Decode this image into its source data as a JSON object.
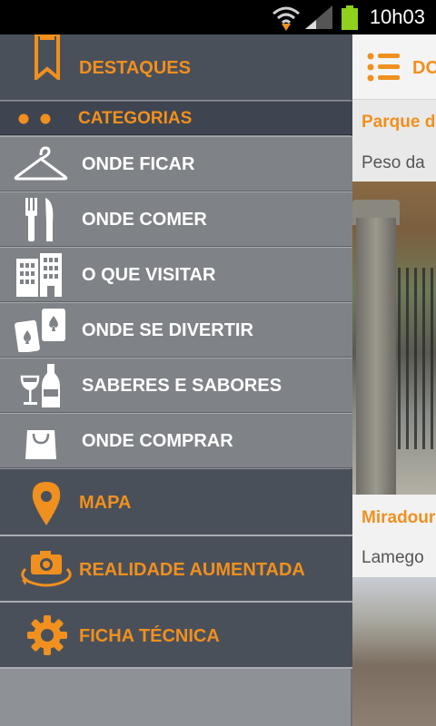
{
  "status_bar": {
    "time": "10h03"
  },
  "drawer": {
    "destaques_label": "DESTAQUES",
    "categorias_label": "CATEGORIAS",
    "categories": [
      {
        "label": "ONDE FICAR",
        "icon": "hanger-icon"
      },
      {
        "label": "ONDE COMER",
        "icon": "fork-knife-icon"
      },
      {
        "label": "O QUE VISITAR",
        "icon": "buildings-icon"
      },
      {
        "label": "ONDE SE DIVERTIR",
        "icon": "cards-icon"
      },
      {
        "label": "SABERES E SABORES",
        "icon": "wine-icon"
      },
      {
        "label": "ONDE COMPRAR",
        "icon": "shopping-bag-icon"
      }
    ],
    "mapa_label": "MAPA",
    "realidade_label": "REALIDADE AUMENTADA",
    "ficha_label": "FICHA TÉCNICA"
  },
  "content": {
    "header_label": "DO",
    "items": [
      {
        "title": "Parque d",
        "subtitle": "Peso da"
      },
      {
        "title": "Miradour",
        "subtitle": "Lamego"
      }
    ]
  },
  "colors": {
    "accent": "#f0901e",
    "drawer_dark": "#4a505a",
    "drawer_item": "#7f8387"
  }
}
